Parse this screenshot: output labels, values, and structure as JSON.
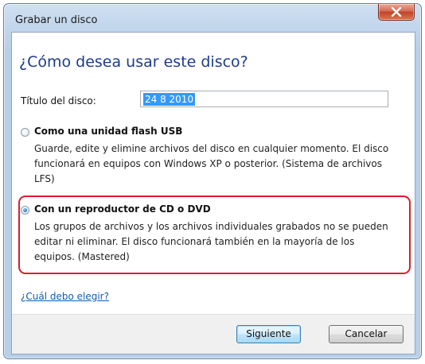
{
  "window": {
    "title": "Grabar un disco"
  },
  "dialog": {
    "heading": "¿Cómo desea usar este disco?",
    "disc_title_label": "Título del disco:",
    "disc_title_value": "24 8 2010",
    "options": [
      {
        "title": "Como una unidad flash USB",
        "description": "Guarde, edite y elimine archivos del disco en cualquier momento. El disco funcionará en equipos con Windows XP o posterior. (Sistema de archivos LFS)",
        "selected": false
      },
      {
        "title": "Con un reproductor de CD o DVD",
        "description": "Los grupos de archivos y los archivos individuales grabados no se pueden editar ni eliminar. El disco funcionará también en la mayoría de los equipos. (Mastered)",
        "selected": true
      }
    ],
    "help_link": "¿Cuál debo elegir?"
  },
  "footer": {
    "next_label": "Siguiente",
    "cancel_label": "Cancelar"
  },
  "colors": {
    "heading": "#1e3c8c",
    "link": "#0a5fb4",
    "highlight": "#d8202a",
    "selection": "#3399ff"
  },
  "icons": {
    "close": "close-icon"
  }
}
